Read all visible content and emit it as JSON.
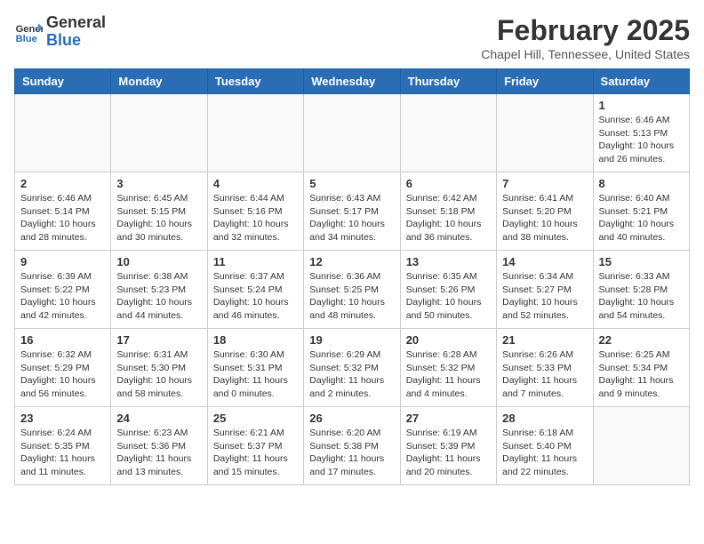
{
  "header": {
    "logo_general": "General",
    "logo_blue": "Blue",
    "month_year": "February 2025",
    "location": "Chapel Hill, Tennessee, United States"
  },
  "weekdays": [
    "Sunday",
    "Monday",
    "Tuesday",
    "Wednesday",
    "Thursday",
    "Friday",
    "Saturday"
  ],
  "weeks": [
    [
      {
        "day": "",
        "info": ""
      },
      {
        "day": "",
        "info": ""
      },
      {
        "day": "",
        "info": ""
      },
      {
        "day": "",
        "info": ""
      },
      {
        "day": "",
        "info": ""
      },
      {
        "day": "",
        "info": ""
      },
      {
        "day": "1",
        "info": "Sunrise: 6:46 AM\nSunset: 5:13 PM\nDaylight: 10 hours and 26 minutes."
      }
    ],
    [
      {
        "day": "2",
        "info": "Sunrise: 6:46 AM\nSunset: 5:14 PM\nDaylight: 10 hours and 28 minutes."
      },
      {
        "day": "3",
        "info": "Sunrise: 6:45 AM\nSunset: 5:15 PM\nDaylight: 10 hours and 30 minutes."
      },
      {
        "day": "4",
        "info": "Sunrise: 6:44 AM\nSunset: 5:16 PM\nDaylight: 10 hours and 32 minutes."
      },
      {
        "day": "5",
        "info": "Sunrise: 6:43 AM\nSunset: 5:17 PM\nDaylight: 10 hours and 34 minutes."
      },
      {
        "day": "6",
        "info": "Sunrise: 6:42 AM\nSunset: 5:18 PM\nDaylight: 10 hours and 36 minutes."
      },
      {
        "day": "7",
        "info": "Sunrise: 6:41 AM\nSunset: 5:20 PM\nDaylight: 10 hours and 38 minutes."
      },
      {
        "day": "8",
        "info": "Sunrise: 6:40 AM\nSunset: 5:21 PM\nDaylight: 10 hours and 40 minutes."
      }
    ],
    [
      {
        "day": "9",
        "info": "Sunrise: 6:39 AM\nSunset: 5:22 PM\nDaylight: 10 hours and 42 minutes."
      },
      {
        "day": "10",
        "info": "Sunrise: 6:38 AM\nSunset: 5:23 PM\nDaylight: 10 hours and 44 minutes."
      },
      {
        "day": "11",
        "info": "Sunrise: 6:37 AM\nSunset: 5:24 PM\nDaylight: 10 hours and 46 minutes."
      },
      {
        "day": "12",
        "info": "Sunrise: 6:36 AM\nSunset: 5:25 PM\nDaylight: 10 hours and 48 minutes."
      },
      {
        "day": "13",
        "info": "Sunrise: 6:35 AM\nSunset: 5:26 PM\nDaylight: 10 hours and 50 minutes."
      },
      {
        "day": "14",
        "info": "Sunrise: 6:34 AM\nSunset: 5:27 PM\nDaylight: 10 hours and 52 minutes."
      },
      {
        "day": "15",
        "info": "Sunrise: 6:33 AM\nSunset: 5:28 PM\nDaylight: 10 hours and 54 minutes."
      }
    ],
    [
      {
        "day": "16",
        "info": "Sunrise: 6:32 AM\nSunset: 5:29 PM\nDaylight: 10 hours and 56 minutes."
      },
      {
        "day": "17",
        "info": "Sunrise: 6:31 AM\nSunset: 5:30 PM\nDaylight: 10 hours and 58 minutes."
      },
      {
        "day": "18",
        "info": "Sunrise: 6:30 AM\nSunset: 5:31 PM\nDaylight: 11 hours and 0 minutes."
      },
      {
        "day": "19",
        "info": "Sunrise: 6:29 AM\nSunset: 5:32 PM\nDaylight: 11 hours and 2 minutes."
      },
      {
        "day": "20",
        "info": "Sunrise: 6:28 AM\nSunset: 5:32 PM\nDaylight: 11 hours and 4 minutes."
      },
      {
        "day": "21",
        "info": "Sunrise: 6:26 AM\nSunset: 5:33 PM\nDaylight: 11 hours and 7 minutes."
      },
      {
        "day": "22",
        "info": "Sunrise: 6:25 AM\nSunset: 5:34 PM\nDaylight: 11 hours and 9 minutes."
      }
    ],
    [
      {
        "day": "23",
        "info": "Sunrise: 6:24 AM\nSunset: 5:35 PM\nDaylight: 11 hours and 11 minutes."
      },
      {
        "day": "24",
        "info": "Sunrise: 6:23 AM\nSunset: 5:36 PM\nDaylight: 11 hours and 13 minutes."
      },
      {
        "day": "25",
        "info": "Sunrise: 6:21 AM\nSunset: 5:37 PM\nDaylight: 11 hours and 15 minutes."
      },
      {
        "day": "26",
        "info": "Sunrise: 6:20 AM\nSunset: 5:38 PM\nDaylight: 11 hours and 17 minutes."
      },
      {
        "day": "27",
        "info": "Sunrise: 6:19 AM\nSunset: 5:39 PM\nDaylight: 11 hours and 20 minutes."
      },
      {
        "day": "28",
        "info": "Sunrise: 6:18 AM\nSunset: 5:40 PM\nDaylight: 11 hours and 22 minutes."
      },
      {
        "day": "",
        "info": ""
      }
    ]
  ]
}
